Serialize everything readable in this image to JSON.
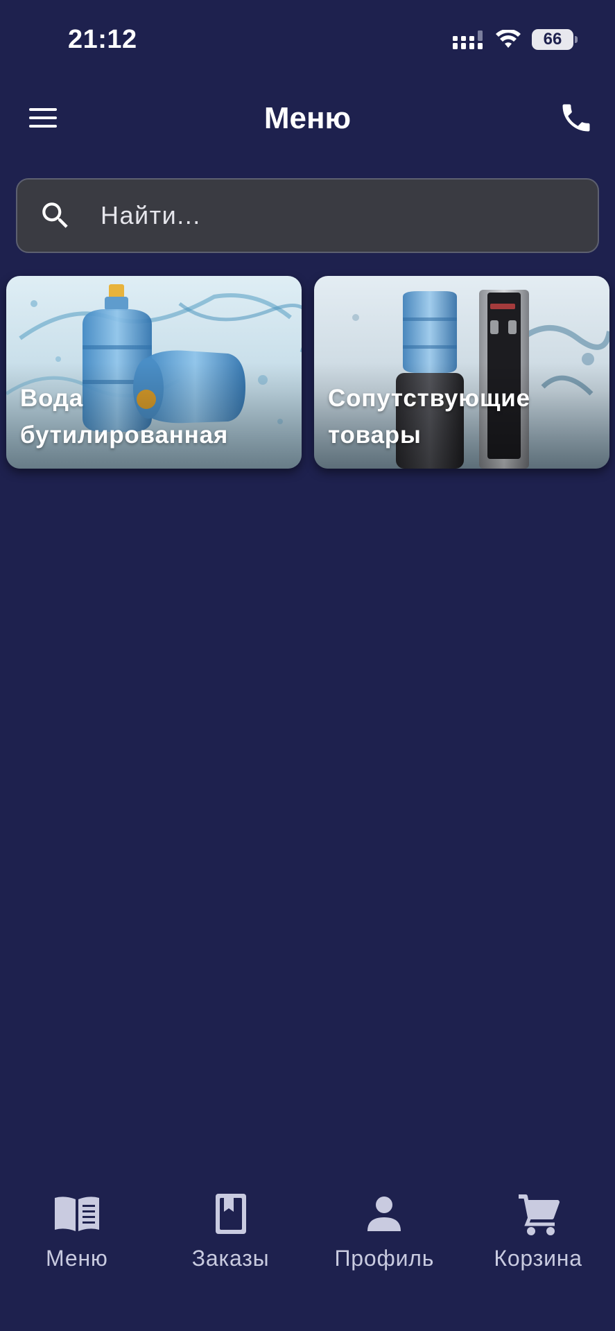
{
  "status_bar": {
    "time": "21:12",
    "battery": "66",
    "icons": [
      "signal-icon",
      "wifi-icon",
      "battery-icon"
    ]
  },
  "header": {
    "title": "Меню",
    "left_icon": "hamburger-menu-icon",
    "right_icon": "phone-icon"
  },
  "search": {
    "placeholder": "Найти...",
    "value": "",
    "icon": "search-icon"
  },
  "categories": [
    {
      "label": "Вода бутилированная",
      "image": "water-bottles-image"
    },
    {
      "label": "Сопутствующие товары",
      "image": "water-coolers-image"
    }
  ],
  "bottom_nav": [
    {
      "label": "Меню",
      "icon": "book-icon"
    },
    {
      "label": "Заказы",
      "icon": "bookmark-book-icon"
    },
    {
      "label": "Профиль",
      "icon": "person-icon"
    },
    {
      "label": "Корзина",
      "icon": "cart-icon"
    }
  ],
  "colors": {
    "background": "#1e214e",
    "search_bg": "#3a3b42",
    "nav_inactive": "#c9cbe0",
    "text": "#ffffff"
  }
}
